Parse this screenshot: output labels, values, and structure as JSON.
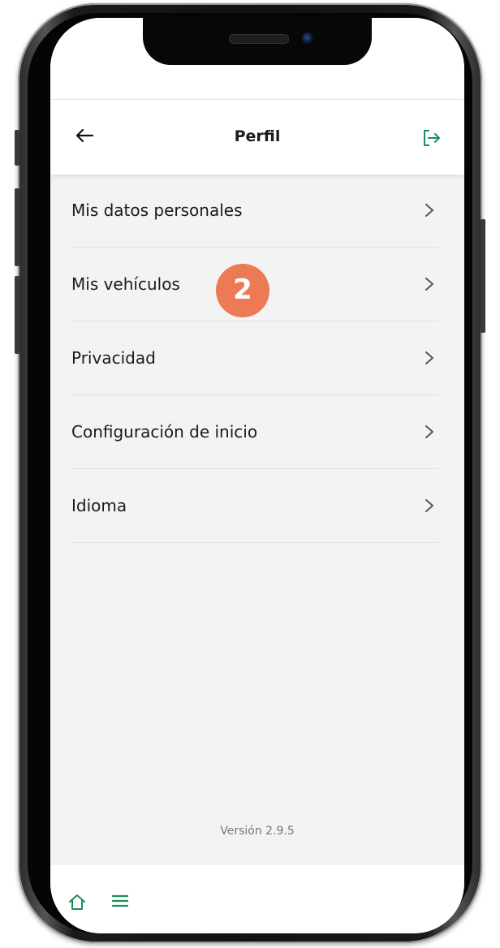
{
  "header": {
    "title": "Perfil",
    "back_icon": "arrow-left-icon",
    "logout_icon": "logout-icon",
    "accent_color": "#1a8f5a"
  },
  "menu": {
    "items": [
      {
        "label": "Mis datos personales"
      },
      {
        "label": "Mis vehículos",
        "badge": "2"
      },
      {
        "label": "Privacidad"
      },
      {
        "label": "Configuración de inicio"
      },
      {
        "label": "Idioma"
      }
    ]
  },
  "footer": {
    "version": "Versión 2.9.5"
  },
  "bottom_nav": {
    "home_icon": "home-icon",
    "menu_icon": "hamburger-menu-icon"
  },
  "colors": {
    "badge": "#ec7a55",
    "accent": "#1a8f5a"
  }
}
